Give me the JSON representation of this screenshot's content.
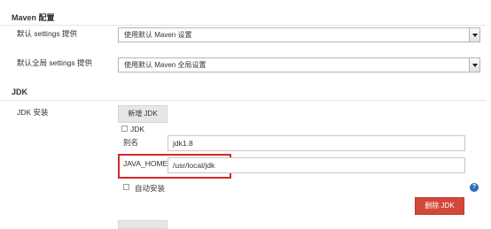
{
  "maven": {
    "section_title": "Maven 配置",
    "settings_label": "默认 settings 提供",
    "settings_value": "使用默认 Maven 设置",
    "global_settings_label": "默认全局 settings 提供",
    "global_settings_value": "使用默认 Maven 全局设置"
  },
  "jdk": {
    "section_title": "JDK",
    "install_label": "JDK 安装",
    "add_button": "新增 JDK",
    "item_header": "JDK",
    "alias_label": "别名",
    "alias_value": "jdk1.8",
    "java_home_label": "JAVA_HOME",
    "java_home_value": "/usr/local/jdk",
    "auto_install_label": "自动安装",
    "delete_button": "删除 JDK",
    "help_icon": "?"
  },
  "colors": {
    "highlight": "#d9252a",
    "delete_button": "#d24939",
    "help_icon": "#2e6bb7"
  }
}
